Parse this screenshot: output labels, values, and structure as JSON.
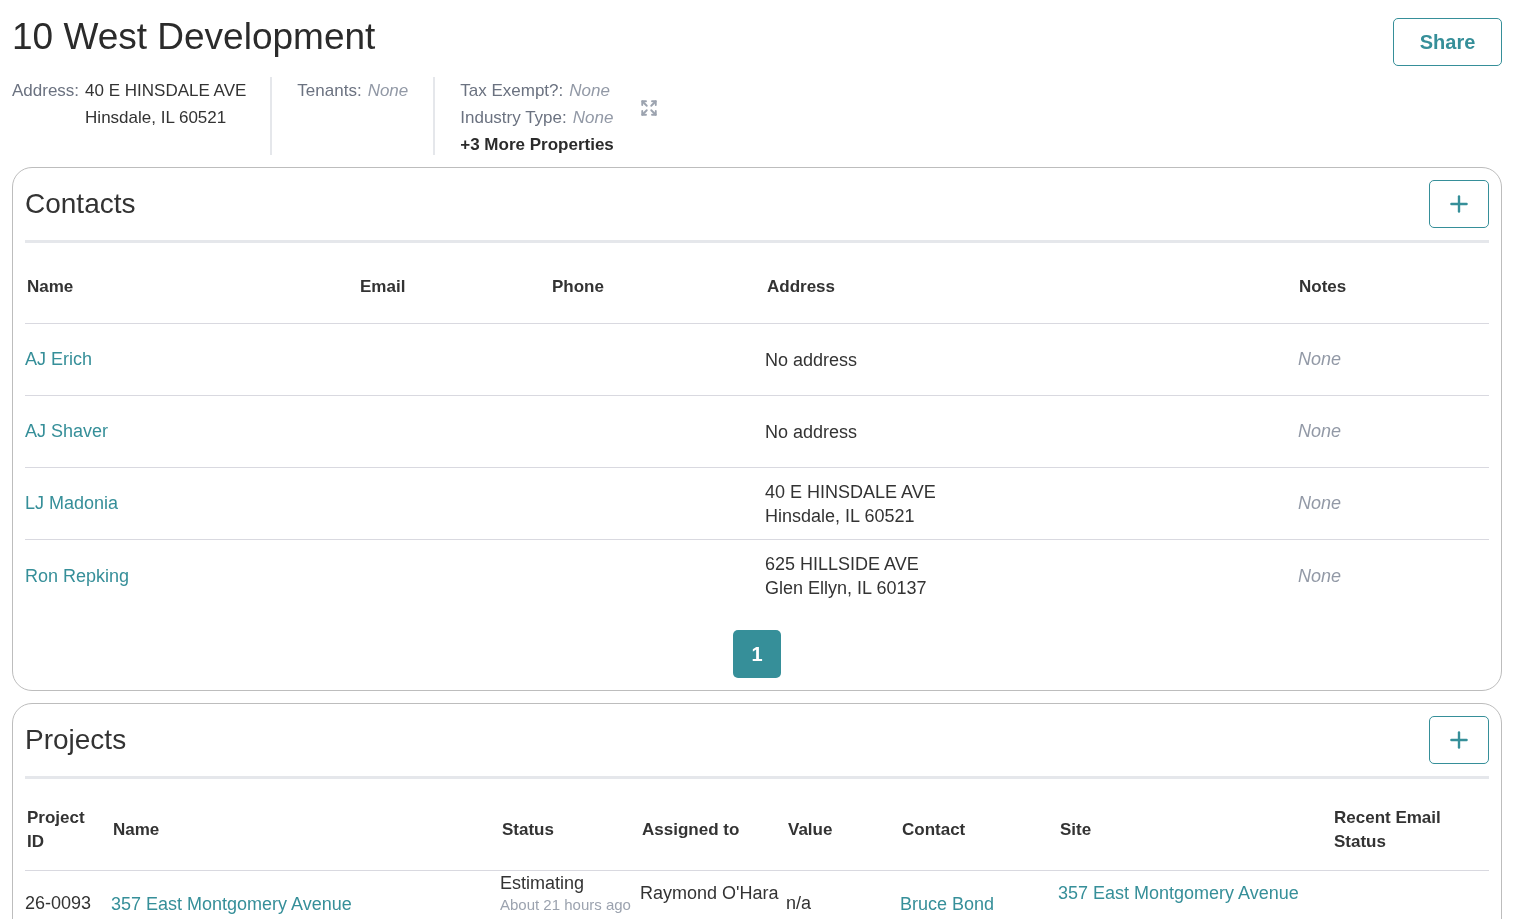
{
  "page": {
    "title": "10 West Development",
    "share_button": "Share"
  },
  "property_groups": [
    {
      "fields": [
        {
          "kind": "text",
          "label": "Address:",
          "lines": [
            "40 E HINSDALE AVE",
            "Hinsdale, IL 60521"
          ]
        }
      ]
    },
    {
      "fields": [
        {
          "kind": "none",
          "label": "Tenants:",
          "value": "None"
        }
      ]
    },
    {
      "fields": [
        {
          "kind": "none",
          "label": "Tax Exempt?:",
          "value": "None"
        },
        {
          "kind": "none",
          "label": "Industry Type:",
          "value": "None"
        }
      ],
      "more_link": "+3 More Properties",
      "expandable": true
    }
  ],
  "contacts": {
    "title": "Contacts",
    "columns": [
      "Name",
      "Email",
      "Phone",
      "Address",
      "Notes"
    ],
    "rows": [
      {
        "name": "AJ Erich",
        "address_lines": [
          "No address"
        ],
        "notes": "None"
      },
      {
        "name": "AJ Shaver",
        "address_lines": [
          "No address"
        ],
        "notes": "None"
      },
      {
        "name": "LJ Madonia",
        "address_lines": [
          "40 E HINSDALE AVE",
          "Hinsdale, IL 60521"
        ],
        "notes": "None"
      },
      {
        "name": "Ron Repking",
        "address_lines": [
          "625 HILLSIDE AVE",
          "Glen Ellyn, IL 60137"
        ],
        "notes": "None"
      }
    ],
    "pagination": [
      {
        "label": "1",
        "selected": true
      }
    ]
  },
  "projects": {
    "title": "Projects",
    "columns": [
      "Project ID",
      "Name",
      "Status",
      "Assigned to",
      "Value",
      "Contact",
      "Site",
      "Recent Email Status"
    ],
    "rows": [
      {
        "project_id": "26-0093",
        "name": "357 East Montgomery Avenue",
        "status": "Estimating",
        "status_time": "About 21 hours ago",
        "assigned_to": "Raymond O'Hara",
        "value": "n/a",
        "contact": "Bruce Bond",
        "site_lines": [
          "357 East Montgomery Avenue"
        ]
      }
    ]
  }
}
